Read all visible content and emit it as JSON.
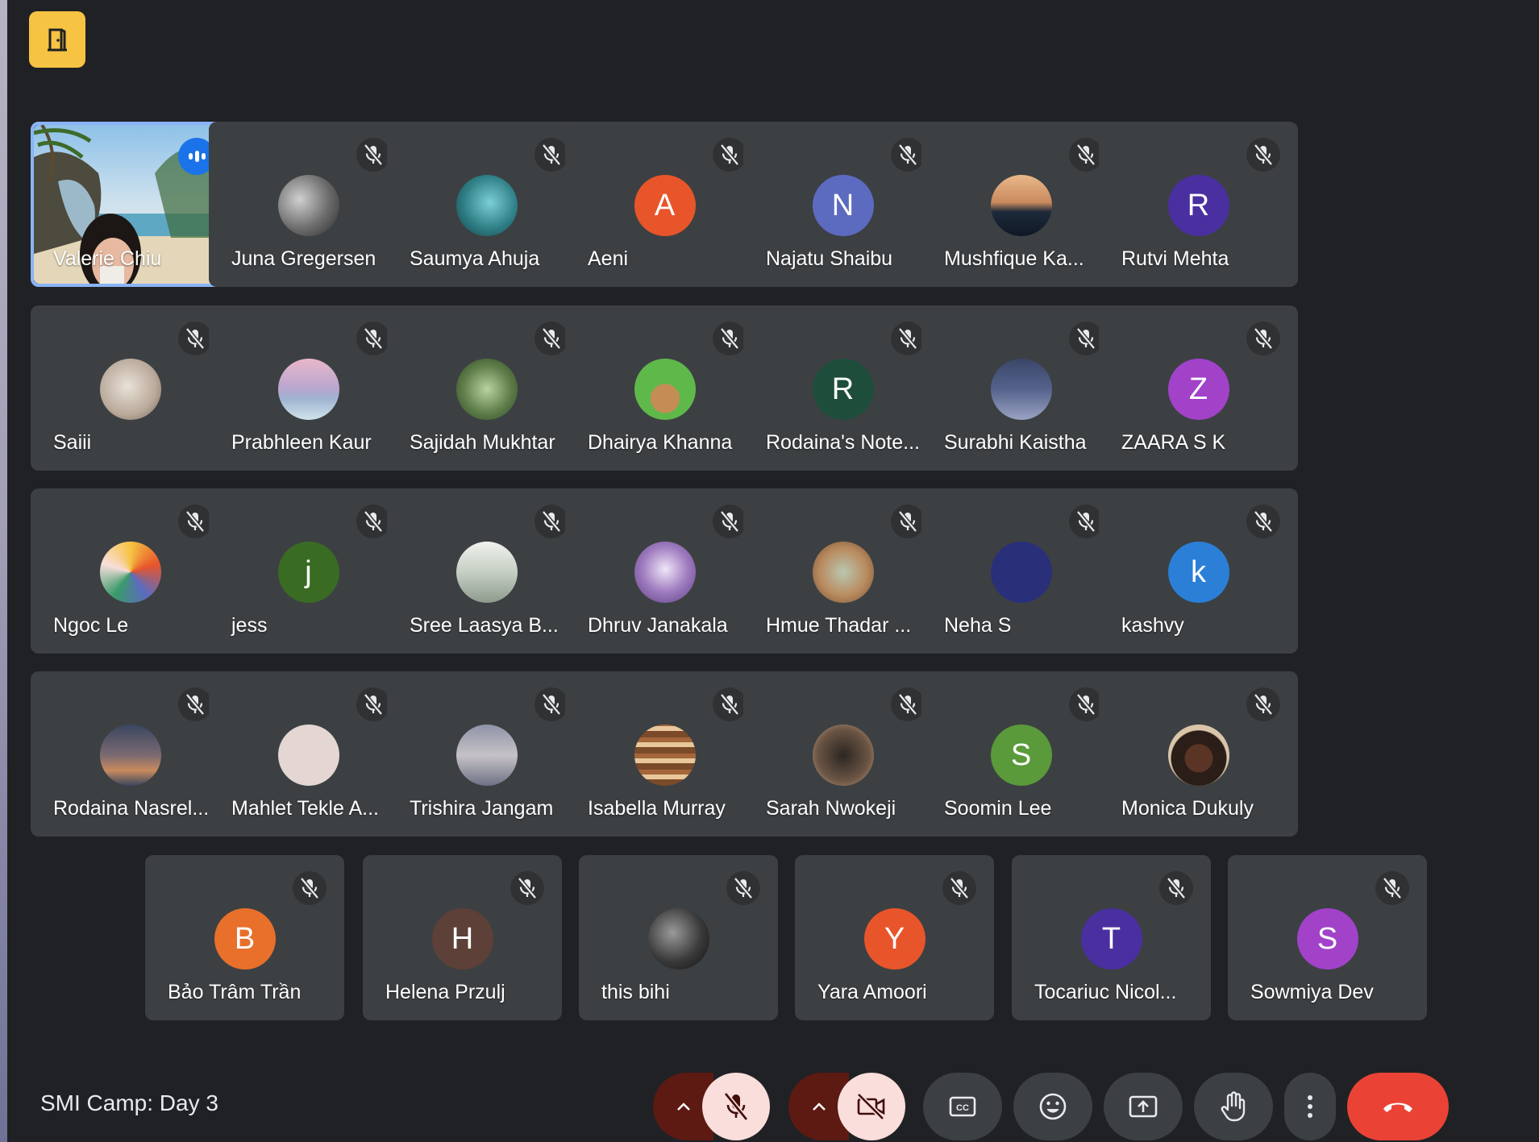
{
  "meeting": {
    "title": "SMI Camp: Day 3"
  },
  "colors": {
    "background": "#202124",
    "tile": "#3c4043",
    "accent": "#8ab4f8",
    "end_call": "#ea4335",
    "room_button": "#f6c342"
  },
  "room_button": {
    "icon": "door-icon"
  },
  "participants": [
    {
      "name": "Valerie Chiu",
      "speaking": true,
      "video": true
    },
    {
      "name": "Juna Gregersen",
      "avatar_image": "train-tracks-photo"
    },
    {
      "name": "Saumya Ahuja",
      "avatar_image": "teal-scenery-photo"
    },
    {
      "name": "Aeni",
      "initial": "A",
      "color": "#e8552b"
    },
    {
      "name": "Najatu Shaibu",
      "initial": "N",
      "color": "#5c6bc0"
    },
    {
      "name": "Mushfique Ka...",
      "avatar_image": "sunset-cat-photo"
    },
    {
      "name": "Rutvi Mehta",
      "initial": "R",
      "color": "#4a2fa0"
    },
    {
      "name": "Saiii",
      "avatar_image": "collage-photo"
    },
    {
      "name": "Prabhleen Kaur",
      "avatar_image": "pink-sky-photo"
    },
    {
      "name": "Sajidah Mukhtar",
      "avatar_image": "green-swirl-photo"
    },
    {
      "name": "Dhairya Khanna",
      "avatar_image": "dog-frog-hat-photo"
    },
    {
      "name": "Rodaina's Note...",
      "initial": "R",
      "color": "#1e4d3b"
    },
    {
      "name": "Surabhi Kaistha",
      "avatar_image": "night-city-photo"
    },
    {
      "name": "ZAARA S K",
      "initial": "Z",
      "color": "#a142c9"
    },
    {
      "name": "Ngoc Le",
      "avatar_image": "colorful-art-photo"
    },
    {
      "name": "jess",
      "initial": "j",
      "color": "#3a6b23"
    },
    {
      "name": "Sree Laasya B...",
      "avatar_image": "waterfall-photo"
    },
    {
      "name": "Dhruv Janakala",
      "avatar_image": "pegasus-photo"
    },
    {
      "name": "Hmue Thadar ...",
      "avatar_image": "toy-photo"
    },
    {
      "name": "Neha S",
      "avatar_image": "navy-circle",
      "color": "#2a2f7a"
    },
    {
      "name": "kashvy",
      "initial": "k",
      "color": "#2b7fd6"
    },
    {
      "name": "Rodaina Nasrel...",
      "avatar_image": "cloud-photo"
    },
    {
      "name": "Mahlet Tekle A...",
      "avatar_image": "name-card-photo"
    },
    {
      "name": "Trishira Jangam",
      "avatar_image": "statue-photo"
    },
    {
      "name": "Isabella Murray",
      "avatar_image": "bookshelf-photo"
    },
    {
      "name": "Sarah Nwokeji",
      "avatar_image": "tree-photo"
    },
    {
      "name": "Soomin Lee",
      "initial": "S",
      "color": "#5a9a3a"
    },
    {
      "name": "Monica Dukuly",
      "avatar_image": "person-photo"
    },
    {
      "name": "Bảo Trâm Trần",
      "initial": "B",
      "color": "#e8702a"
    },
    {
      "name": "Helena Przulj",
      "initial": "H",
      "color": "#5d4037"
    },
    {
      "name": "this bihi",
      "avatar_image": "bw-hands-photo"
    },
    {
      "name": "Yara Amoori",
      "initial": "Y",
      "color": "#e8552b"
    },
    {
      "name": "Tocariuc Nicol...",
      "initial": "T",
      "color": "#4a2fa0"
    },
    {
      "name": "Sowmiya Dev",
      "initial": "S",
      "color": "#a142c9"
    }
  ],
  "controls": {
    "mic": {
      "state": "off",
      "icon": "mic-off-icon"
    },
    "camera": {
      "state": "off",
      "icon": "camera-off-icon"
    },
    "captions": {
      "icon": "closed-captions-icon"
    },
    "reactions": {
      "icon": "emoji-icon"
    },
    "present": {
      "icon": "present-screen-icon"
    },
    "raise_hand": {
      "icon": "hand-icon"
    },
    "more": {
      "icon": "more-vert-icon"
    },
    "leave": {
      "icon": "end-call-icon"
    }
  }
}
